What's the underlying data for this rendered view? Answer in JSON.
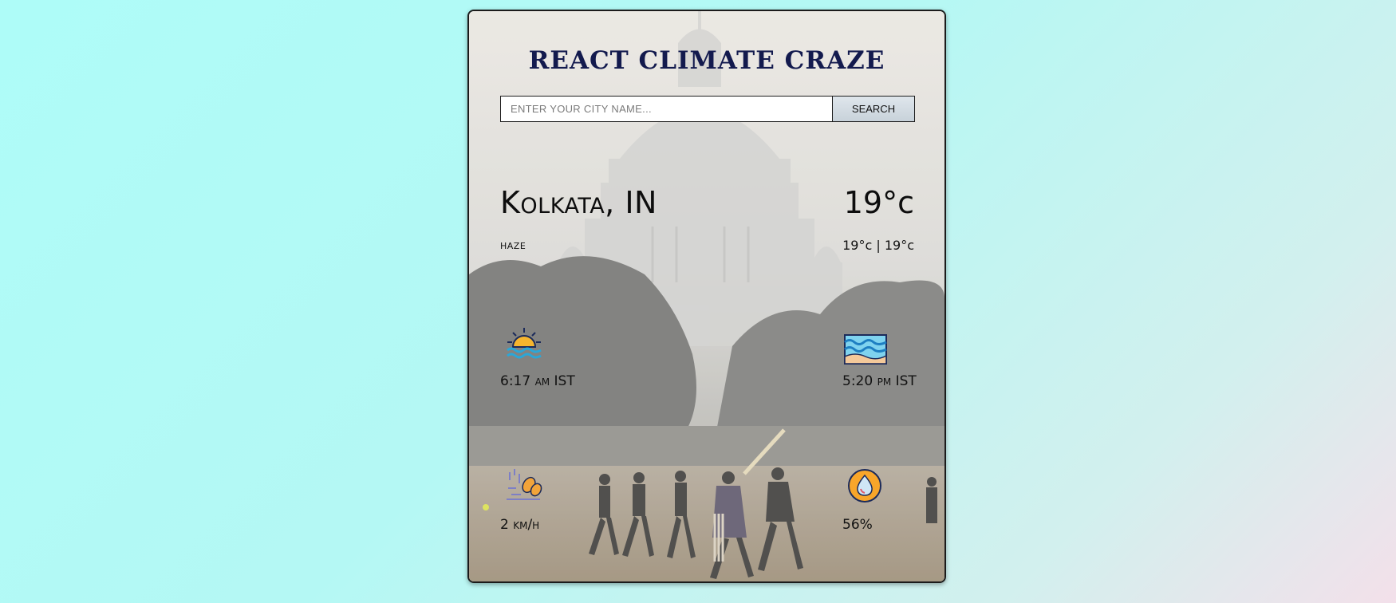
{
  "app": {
    "title": "REACT CLIMATE CRAZE"
  },
  "search": {
    "placeholder": "ENTER YOUR CITY NAME...",
    "value": "",
    "button_label": "SEARCH"
  },
  "weather": {
    "city": "Kolkata, IN",
    "condition": "haze",
    "temperature": "19°c",
    "min_max": "19°c | 19°c"
  },
  "details": {
    "sunrise": "6:17 am IST",
    "sunset": "5:20 pm IST",
    "wind": "2 km/h",
    "humidity": "56%"
  },
  "icons": {
    "sunrise": "sunrise-icon",
    "sunset": "sunset-waves-icon",
    "wind": "wind-icon",
    "humidity": "humidity-icon"
  },
  "colors": {
    "title": "#131a4e",
    "page_bg_start": "#aefcf8",
    "page_bg_end": "#f3e0ea"
  }
}
